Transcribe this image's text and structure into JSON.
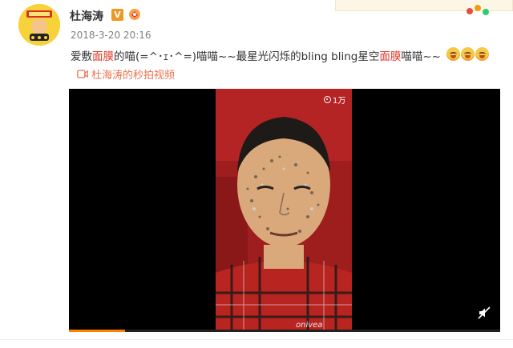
{
  "post": {
    "username": "杜海涛",
    "vip_badge_letter": "V",
    "timestamp": "2018-3-20 20:16",
    "text_parts": [
      "爱敷",
      "面膜",
      "的喵(=^･ｪ･^=)喵喵~~最星光闪烁的bling bling星空",
      "面膜",
      "喵喵~~"
    ],
    "highlight_color": "#e0392a",
    "emoji_count": 3,
    "video_link_label": "杜海涛的秒拍视频"
  },
  "video": {
    "view_count_label": "1万",
    "progress_fraction": 0.13,
    "progress_color": "#ff8200"
  },
  "icons": {
    "video_link": "video-camera-icon",
    "mute": "speaker-muted-icon",
    "views": "eye-icon",
    "level": "fan-level-icon"
  }
}
